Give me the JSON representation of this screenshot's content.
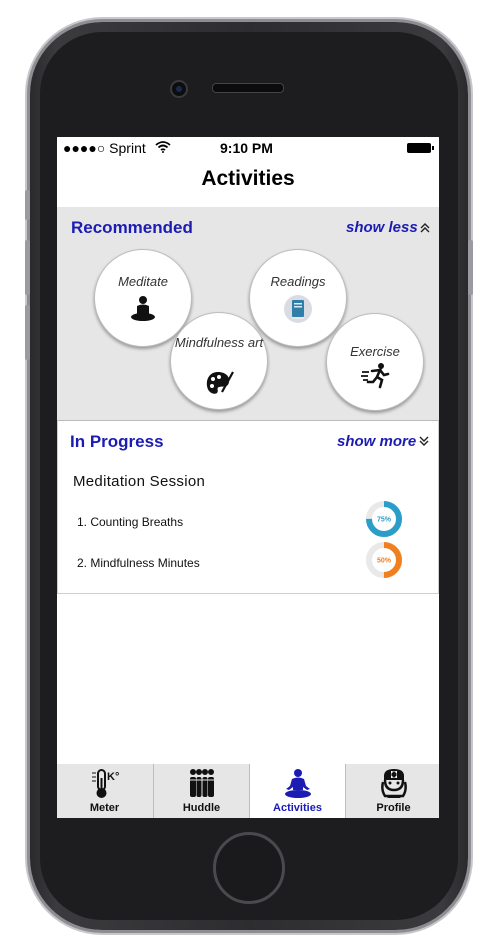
{
  "status": {
    "carrier": "●●●●○ Sprint",
    "time": "9:10 PM"
  },
  "header": {
    "title": "Activities"
  },
  "recommended": {
    "title": "Recommended",
    "toggle": "show less",
    "items": [
      {
        "label": "Meditate",
        "icon": "meditate-icon"
      },
      {
        "label": "Readings",
        "icon": "book-icon"
      },
      {
        "label": "Mindfulness art",
        "icon": "palette-icon"
      },
      {
        "label": "Exercise",
        "icon": "running-icon"
      }
    ]
  },
  "in_progress": {
    "title": "In Progress",
    "toggle": "show more",
    "session_title": "Meditation Session",
    "items": [
      {
        "label": "1. Counting Breaths",
        "progress": 75,
        "progress_label": "75%",
        "color": "#2a9ec9"
      },
      {
        "label": "2. Mindfulness Minutes",
        "progress": 50,
        "progress_label": "50%",
        "color": "#f07f1f"
      }
    ]
  },
  "tabbar": {
    "tabs": [
      {
        "label": "Meter",
        "icon": "thermometer-icon"
      },
      {
        "label": "Huddle",
        "icon": "group-icon"
      },
      {
        "label": "Activities",
        "icon": "meditate-icon"
      },
      {
        "label": "Profile",
        "icon": "nurse-icon"
      }
    ],
    "active": "Activities",
    "accent": "#1c1cb4"
  }
}
